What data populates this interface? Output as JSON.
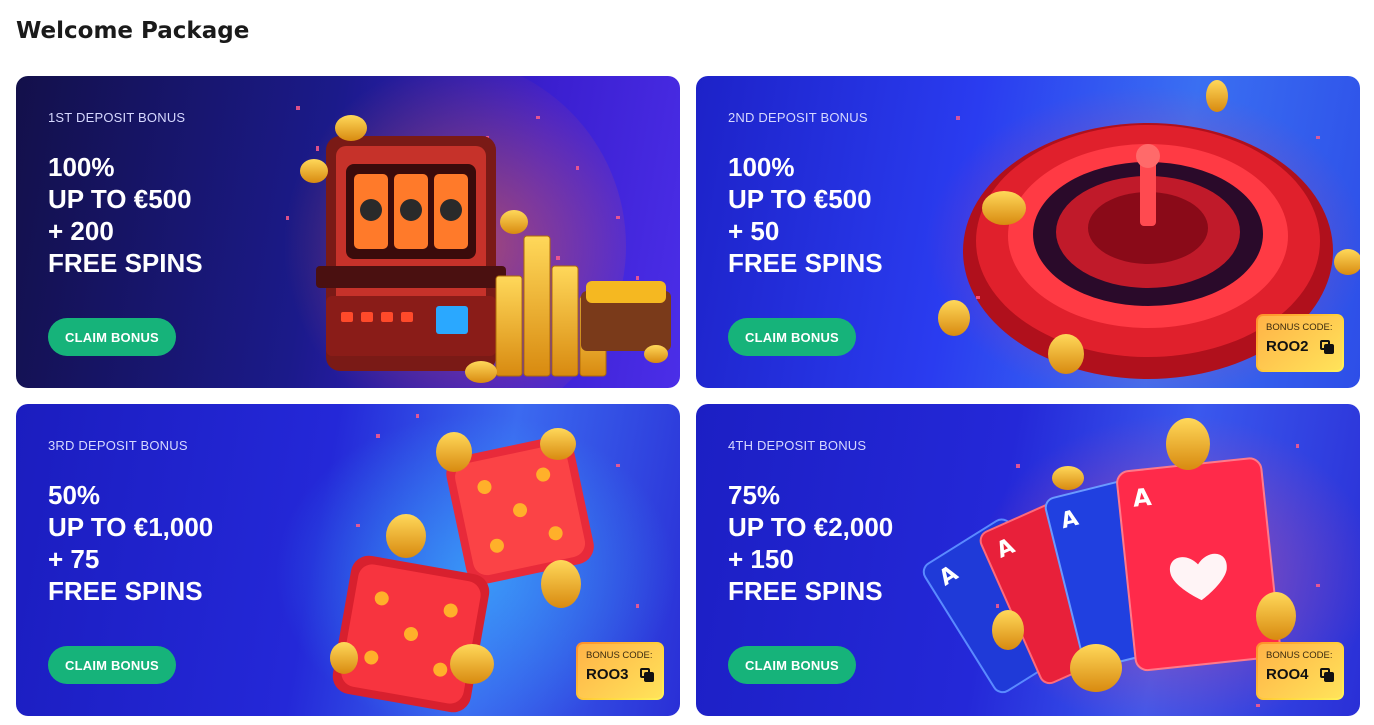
{
  "page": {
    "title": "Welcome Package"
  },
  "cards": [
    {
      "eyebrow": "1ST DEPOSIT BONUS",
      "lines": [
        "100%",
        "UP TO €500",
        "+ 200",
        "FREE SPINS"
      ],
      "button_label": "CLAIM BONUS",
      "illustration": "slot-machine-icon"
    },
    {
      "eyebrow": "2ND DEPOSIT BONUS",
      "lines": [
        "100%",
        "UP TO €500",
        "+ 50",
        "FREE SPINS"
      ],
      "button_label": "CLAIM BONUS",
      "code_label": "BONUS CODE:",
      "code": "ROO2",
      "illustration": "roulette-wheel-icon"
    },
    {
      "eyebrow": "3RD DEPOSIT BONUS",
      "lines": [
        "50%",
        "UP TO €1,000",
        "+ 75",
        "FREE SPINS"
      ],
      "button_label": "CLAIM BONUS",
      "code_label": "BONUS CODE:",
      "code": "ROO3",
      "illustration": "dice-icon"
    },
    {
      "eyebrow": "4TH DEPOSIT BONUS",
      "lines": [
        "75%",
        "UP TO €2,000",
        "+ 150",
        "FREE SPINS"
      ],
      "button_label": "CLAIM BONUS",
      "code_label": "BONUS CODE:",
      "code": "ROO4",
      "illustration": "playing-cards-icon"
    }
  ],
  "colors": {
    "claim_button": "#16b37a",
    "code_box_start": "#ff8a2a",
    "code_box_end": "#fff25a",
    "coin": "#f5b821"
  }
}
